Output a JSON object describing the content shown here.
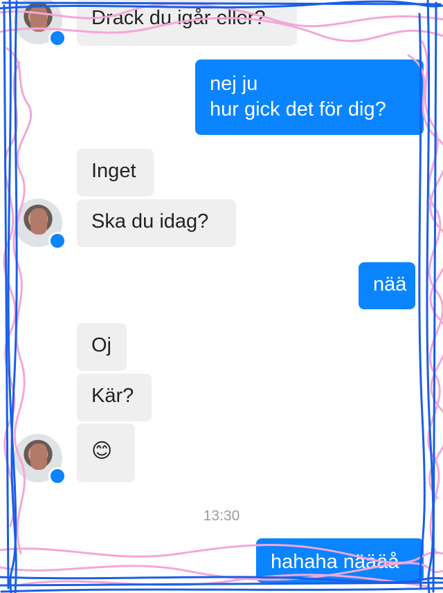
{
  "messages": {
    "m1": "Drack du igår eller?",
    "m2_line1": "nej ju",
    "m2_line2": "hur gick det för dig?",
    "m3": "Inget",
    "m4": "Ska du idag?",
    "m5": "nää",
    "m6": "Oj",
    "m7": "Kär?",
    "m8": "😊",
    "m9": "hahaha näääå"
  },
  "timestamp": "13:30",
  "colors": {
    "outgoing_bubble": "#0a84ff",
    "incoming_bubble": "#efefef",
    "scribble_blue": "#1a5ee8",
    "scribble_pink": "#f4a6d8"
  },
  "icons": {
    "avatar": "contact-avatar",
    "badge": "messenger-badge-icon"
  }
}
